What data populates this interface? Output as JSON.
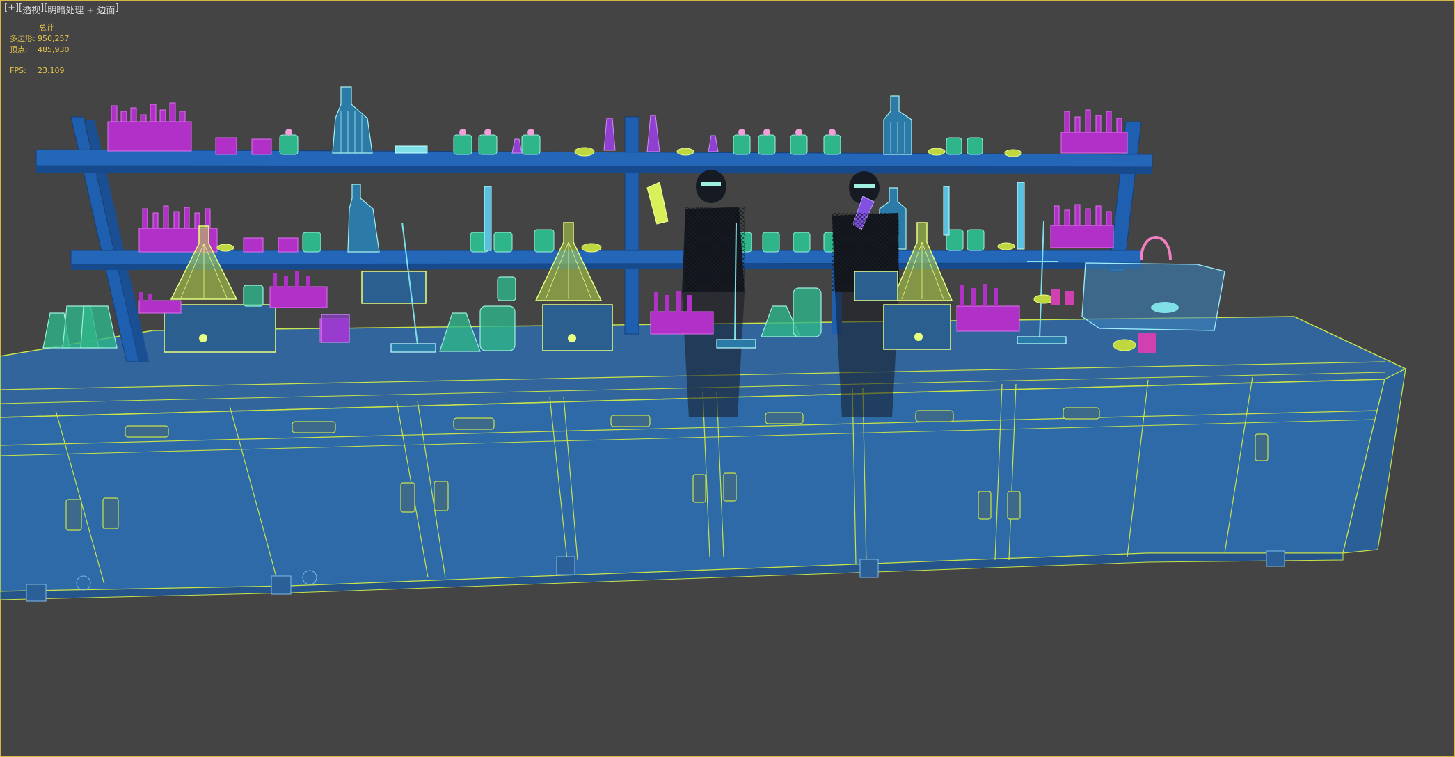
{
  "viewport": {
    "label_parts": [
      "[+]",
      "[",
      "透视",
      "]",
      "[",
      "明暗处理 + 边面",
      "]"
    ]
  },
  "stats": {
    "header": "总计",
    "polys_label": "多边形:",
    "polys_value": "950,257",
    "verts_label": "顶点:",
    "verts_value": "485,930",
    "fps_label": "FPS:",
    "fps_value": "23.109"
  },
  "colors": {
    "background": "#444444",
    "viewport_border": "#d8b74a",
    "overlay_text": "#e3c24a",
    "label_text": "#d8d8d8",
    "cabinet_fill": "#2e6aa8",
    "cabinet_edge": "#c9e34a",
    "shelf": "#1f5fb0",
    "glass_green": "#2fb58a",
    "glass_cyan": "#7fe0e8",
    "flask_yellow": "#d9f05a",
    "rack_magenta": "#b030c8",
    "figure_dark": "#161a22"
  }
}
